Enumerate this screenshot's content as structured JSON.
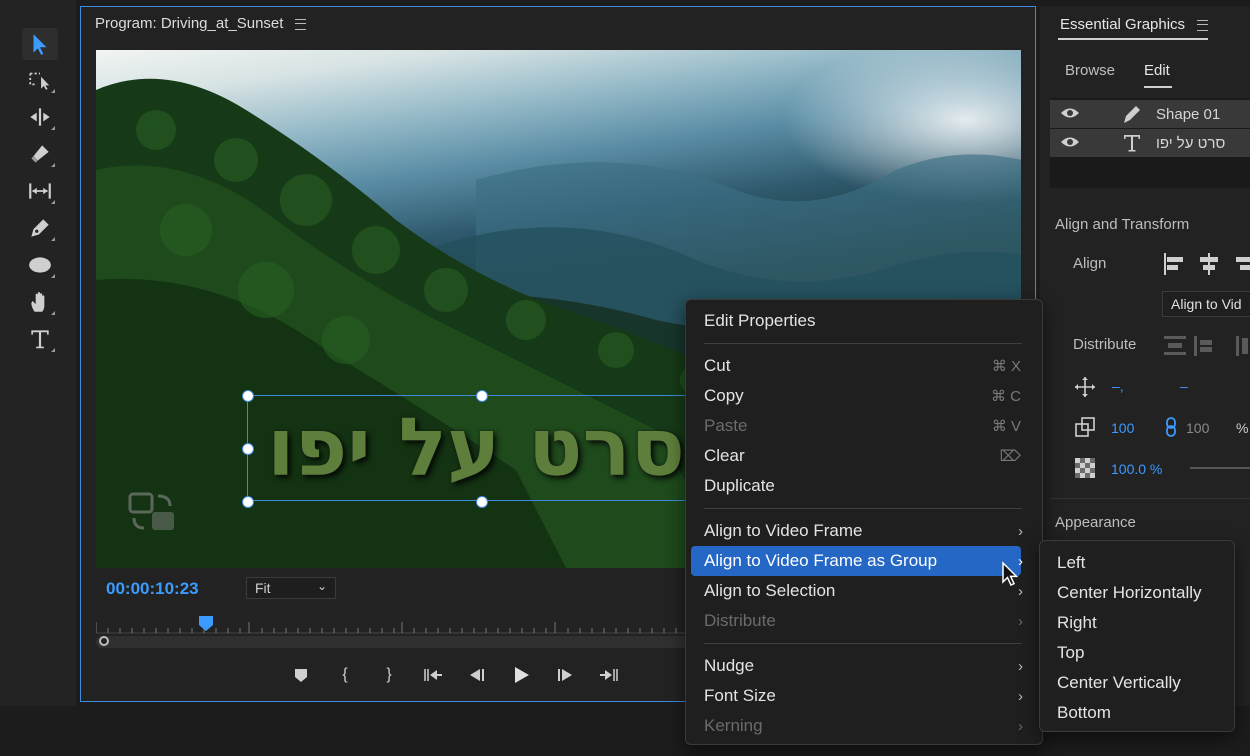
{
  "monitor": {
    "title": "Program: Driving_at_Sunset",
    "timecode": "00:00:10:23",
    "fit": "Fit",
    "overlay_text": "סרט על יפו"
  },
  "essential_graphics": {
    "title": "Essential Graphics",
    "tabs": [
      "Browse",
      "Edit"
    ],
    "active_tab": "Edit",
    "layers": [
      {
        "name": "Shape 01",
        "icon": "pen-icon"
      },
      {
        "name": "סרט על יפו",
        "icon": "text-icon"
      }
    ],
    "align_transform_label": "Align and Transform",
    "align_label": "Align",
    "align_dropdown": "Align to Vid",
    "distribute_label": "Distribute",
    "position_x": "–,",
    "position_y": "–",
    "scale": "100",
    "scale_locked_value": "100",
    "scale_percent": "%",
    "opacity": "100.0 %",
    "appearance_label": "Appearance"
  },
  "context_menu": {
    "items": [
      {
        "label": "Edit Properties"
      },
      {
        "label": "Cut",
        "shortcut": "⌘ X"
      },
      {
        "label": "Copy",
        "shortcut": "⌘ C"
      },
      {
        "label": "Paste",
        "shortcut": "⌘ V",
        "disabled": true
      },
      {
        "label": "Clear",
        "shortcut": "⌦"
      },
      {
        "label": "Duplicate"
      },
      {
        "label": "Align to Video Frame",
        "submenu": true
      },
      {
        "label": "Align to Video Frame as Group",
        "submenu": true,
        "highlighted": true
      },
      {
        "label": "Align to Selection",
        "submenu": true
      },
      {
        "label": "Distribute",
        "submenu": true,
        "disabled": true
      },
      {
        "label": "Nudge",
        "submenu": true
      },
      {
        "label": "Font Size",
        "submenu": true
      },
      {
        "label": "Kerning",
        "submenu": true,
        "disabled": true
      }
    ],
    "arrow": "›"
  },
  "submenu": {
    "items": [
      "Left",
      "Center Horizontally",
      "Right",
      "Top",
      "Center Vertically",
      "Bottom"
    ]
  },
  "colors": {
    "accent": "#3b9bff",
    "menu_highlight": "#2467c4",
    "text_fill": "#5e7f3b"
  }
}
